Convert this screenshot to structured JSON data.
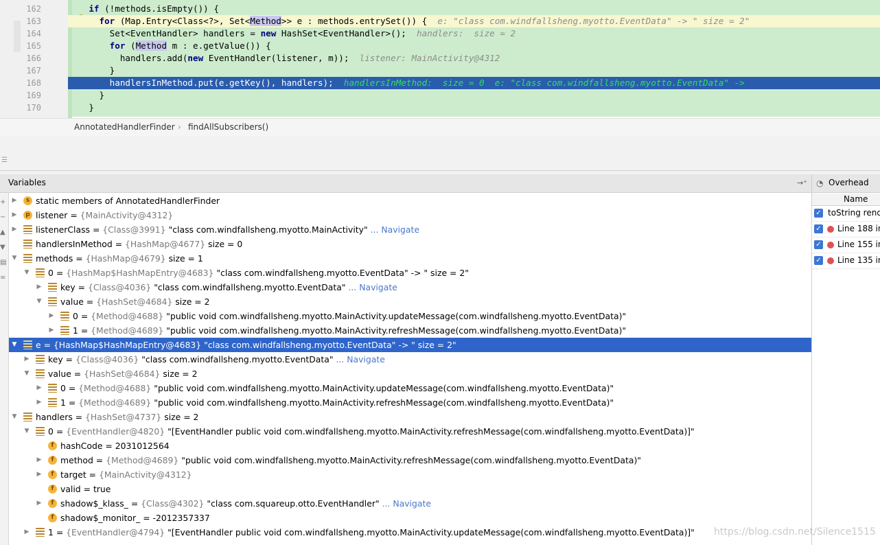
{
  "editor": {
    "line_numbers": [
      "162",
      "163",
      "164",
      "165",
      "166",
      "167",
      "168",
      "169",
      "170"
    ],
    "lines": [
      {
        "indent": "    ",
        "kw": "if",
        "rest": " (!methods.isEmpty()) {"
      },
      {
        "indent": "      ",
        "kw": "for",
        "pre": " (Map.Entry<Class<?>, Set<",
        "hl": "Method",
        ">> e : methods.entrySet()) {": "",
        "post": ">> e : methods.entrySet()) {  ",
        "inline": "e: \"class com.windfallsheng.myotto.EventData\" -> \" size = 2\""
      },
      {
        "indent": "        ",
        "code": "Set<EventHandler> handlers = ",
        "kw": "new",
        "post": " HashSet<EventHandler>();  ",
        "inline": "handlers:  size = 2"
      },
      {
        "indent": "        ",
        "kw": "for",
        "pre": " (",
        "hl": "Method",
        "post": " m : e.getValue()) {"
      },
      {
        "indent": "          ",
        "code": "handlers.add(",
        "kw": "new",
        "post": " EventHandler(listener, m));  ",
        "inline": "listener: MainActivity@4312"
      },
      {
        "indent": "        ",
        "code": "}"
      },
      {
        "indent": "        ",
        "code": "handlersInMethod.put(e.getKey(), handlers);  ",
        "inline": "handlersInMethod:  size = 0  e: \"class com.windfallsheng.myotto.EventData\" ->"
      },
      {
        "indent": "      ",
        "code": "}"
      },
      {
        "indent": "    ",
        "code": "}"
      }
    ]
  },
  "breadcrumb": {
    "class_name": "AnnotatedHandlerFinder",
    "separator": "›",
    "method": "findAllSubscribers()"
  },
  "variables_panel": {
    "title": "Variables"
  },
  "variables": [
    {
      "name": "static members of AnnotatedHandlerFinder",
      "label": "static",
      "type": "",
      "value": "",
      "extra": ""
    },
    {
      "name": "listener",
      "type": "{MainActivity@4312}",
      "value": "",
      "extra": ""
    },
    {
      "name": "listenerClass",
      "type": "{Class@3991}",
      "value": "\"class com.windfallsheng.myotto.MainActivity\"",
      "extra": "... Navigate"
    },
    {
      "name": "handlersInMethod",
      "type": "{HashMap@4677}",
      "value": "size = 0",
      "extra": ""
    },
    {
      "name": "methods",
      "type": "{HashMap@4679}",
      "value": "size = 1",
      "extra": ""
    },
    {
      "name": "0",
      "type": "{HashMap$HashMapEntry@4683}",
      "value": "\"class com.windfallsheng.myotto.EventData\" -> \" size = 2\"",
      "extra": ""
    },
    {
      "name": "key",
      "type": "{Class@4036}",
      "value": "\"class com.windfallsheng.myotto.EventData\"",
      "extra": "... Navigate"
    },
    {
      "name": "value",
      "type": "{HashSet@4684}",
      "value": "size = 2",
      "extra": ""
    },
    {
      "name": "0",
      "type": "{Method@4688}",
      "value": "\"public void com.windfallsheng.myotto.MainActivity.updateMessage(com.windfallsheng.myotto.EventData)\"",
      "extra": ""
    },
    {
      "name": "1",
      "type": "{Method@4689}",
      "value": "\"public void com.windfallsheng.myotto.MainActivity.refreshMessage(com.windfallsheng.myotto.EventData)\"",
      "extra": ""
    },
    {
      "name": "e",
      "type": "{HashMap$HashMapEntry@4683}",
      "value": "\"class com.windfallsheng.myotto.EventData\" -> \" size = 2\"",
      "extra": ""
    },
    {
      "name": "key",
      "type": "{Class@4036}",
      "value": "\"class com.windfallsheng.myotto.EventData\"",
      "extra": "... Navigate"
    },
    {
      "name": "value",
      "type": "{HashSet@4684}",
      "value": "size = 2",
      "extra": ""
    },
    {
      "name": "0",
      "type": "{Method@4688}",
      "value": "\"public void com.windfallsheng.myotto.MainActivity.updateMessage(com.windfallsheng.myotto.EventData)\"",
      "extra": ""
    },
    {
      "name": "1",
      "type": "{Method@4689}",
      "value": "\"public void com.windfallsheng.myotto.MainActivity.refreshMessage(com.windfallsheng.myotto.EventData)\"",
      "extra": ""
    },
    {
      "name": "handlers",
      "type": "{HashSet@4737}",
      "value": "size = 2",
      "extra": ""
    },
    {
      "name": "0",
      "type": "{EventHandler@4820}",
      "value": "\"[EventHandler public void com.windfallsheng.myotto.MainActivity.refreshMessage(com.windfallsheng.myotto.EventData)]\"",
      "extra": ""
    },
    {
      "name": "hashCode",
      "type": "",
      "value": "2031012564",
      "extra": ""
    },
    {
      "name": "method",
      "type": "{Method@4689}",
      "value": "\"public void com.windfallsheng.myotto.MainActivity.refreshMessage(com.windfallsheng.myotto.EventData)\"",
      "extra": ""
    },
    {
      "name": "target",
      "type": "{MainActivity@4312}",
      "value": "",
      "extra": ""
    },
    {
      "name": "valid",
      "type": "",
      "value": "true",
      "extra": ""
    },
    {
      "name": "shadow$_klass_",
      "type": "{Class@4302}",
      "value": "\"class com.squareup.otto.EventHandler\"",
      "extra": "... Navigate"
    },
    {
      "name": "shadow$_monitor_",
      "type": "",
      "value": "-2012357337",
      "extra": ""
    },
    {
      "name": "1",
      "type": "{EventHandler@4794}",
      "value": "\"[EventHandler public void com.windfallsheng.myotto.MainActivity.updateMessage(com.windfallsheng.myotto.EventData)]\"",
      "extra": ""
    }
  ],
  "right_panel": {
    "title": "Overhead",
    "column": "Name",
    "rows": [
      "toString rend",
      "Line 188 in",
      "Line 155 in",
      "Line 135 in"
    ]
  },
  "watermark": "https://blog.csdn.net/Silence1515",
  "colors": {
    "selection": "#2f65ca",
    "editor_bg": "#cdeccd",
    "exec_line": "#2a5cad",
    "inline_hint": "#31e05f"
  }
}
